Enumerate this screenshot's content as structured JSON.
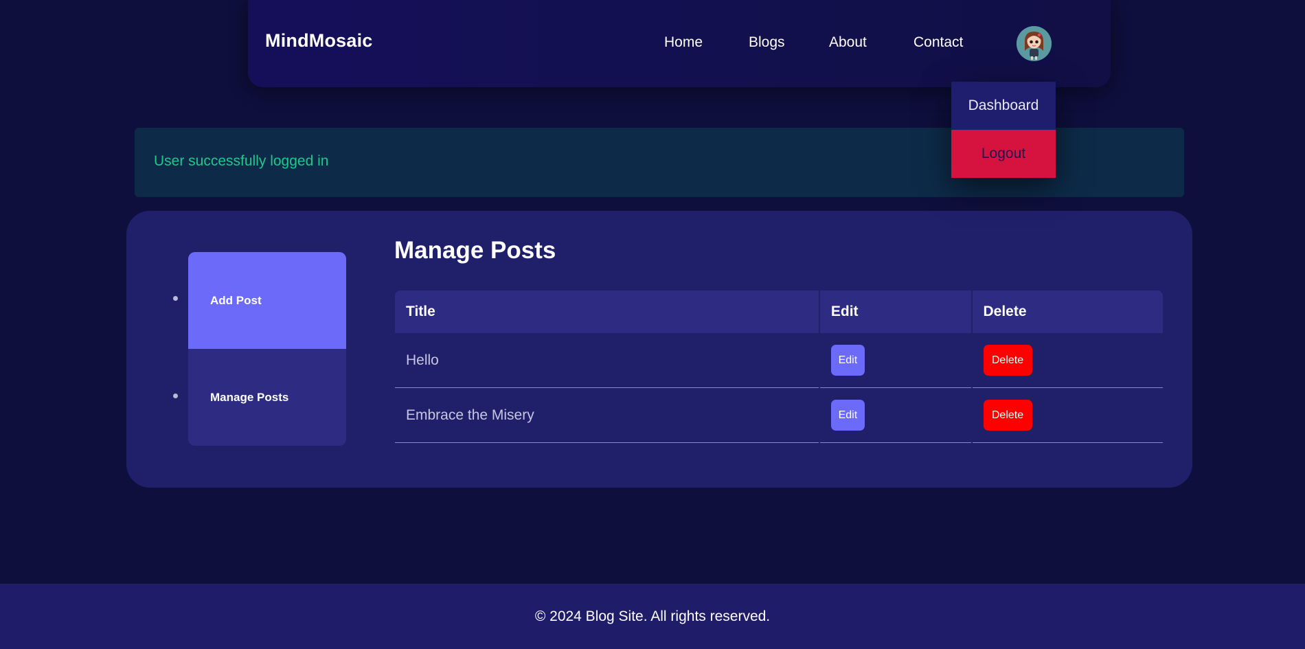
{
  "header": {
    "logo": "MindMosaic",
    "nav": [
      "Home",
      "Blogs",
      "About",
      "Contact"
    ],
    "avatar_icon": "user-avatar-icon"
  },
  "dropdown": {
    "items": [
      "Dashboard",
      "Logout"
    ]
  },
  "alert": {
    "message": "User successfully logged in"
  },
  "sidebar": {
    "items": [
      "Add Post",
      "Manage Posts"
    ],
    "active": "Add Post"
  },
  "main": {
    "title": "Manage Posts",
    "table": {
      "headers": [
        "Title",
        "Edit",
        "Delete"
      ],
      "rows": [
        {
          "title": "Hello",
          "edit": "Edit",
          "delete": "Delete"
        },
        {
          "title": "Embrace the Misery",
          "edit": "Edit",
          "delete": "Delete"
        }
      ]
    }
  },
  "footer": {
    "text": "© 2024 Blog Site. All rights reserved."
  },
  "colors": {
    "background": "#0e0f3c",
    "accent": "#6c6af8",
    "danger": "#ff0000",
    "logout": "#d6123f",
    "success_text": "#1ec98a"
  }
}
